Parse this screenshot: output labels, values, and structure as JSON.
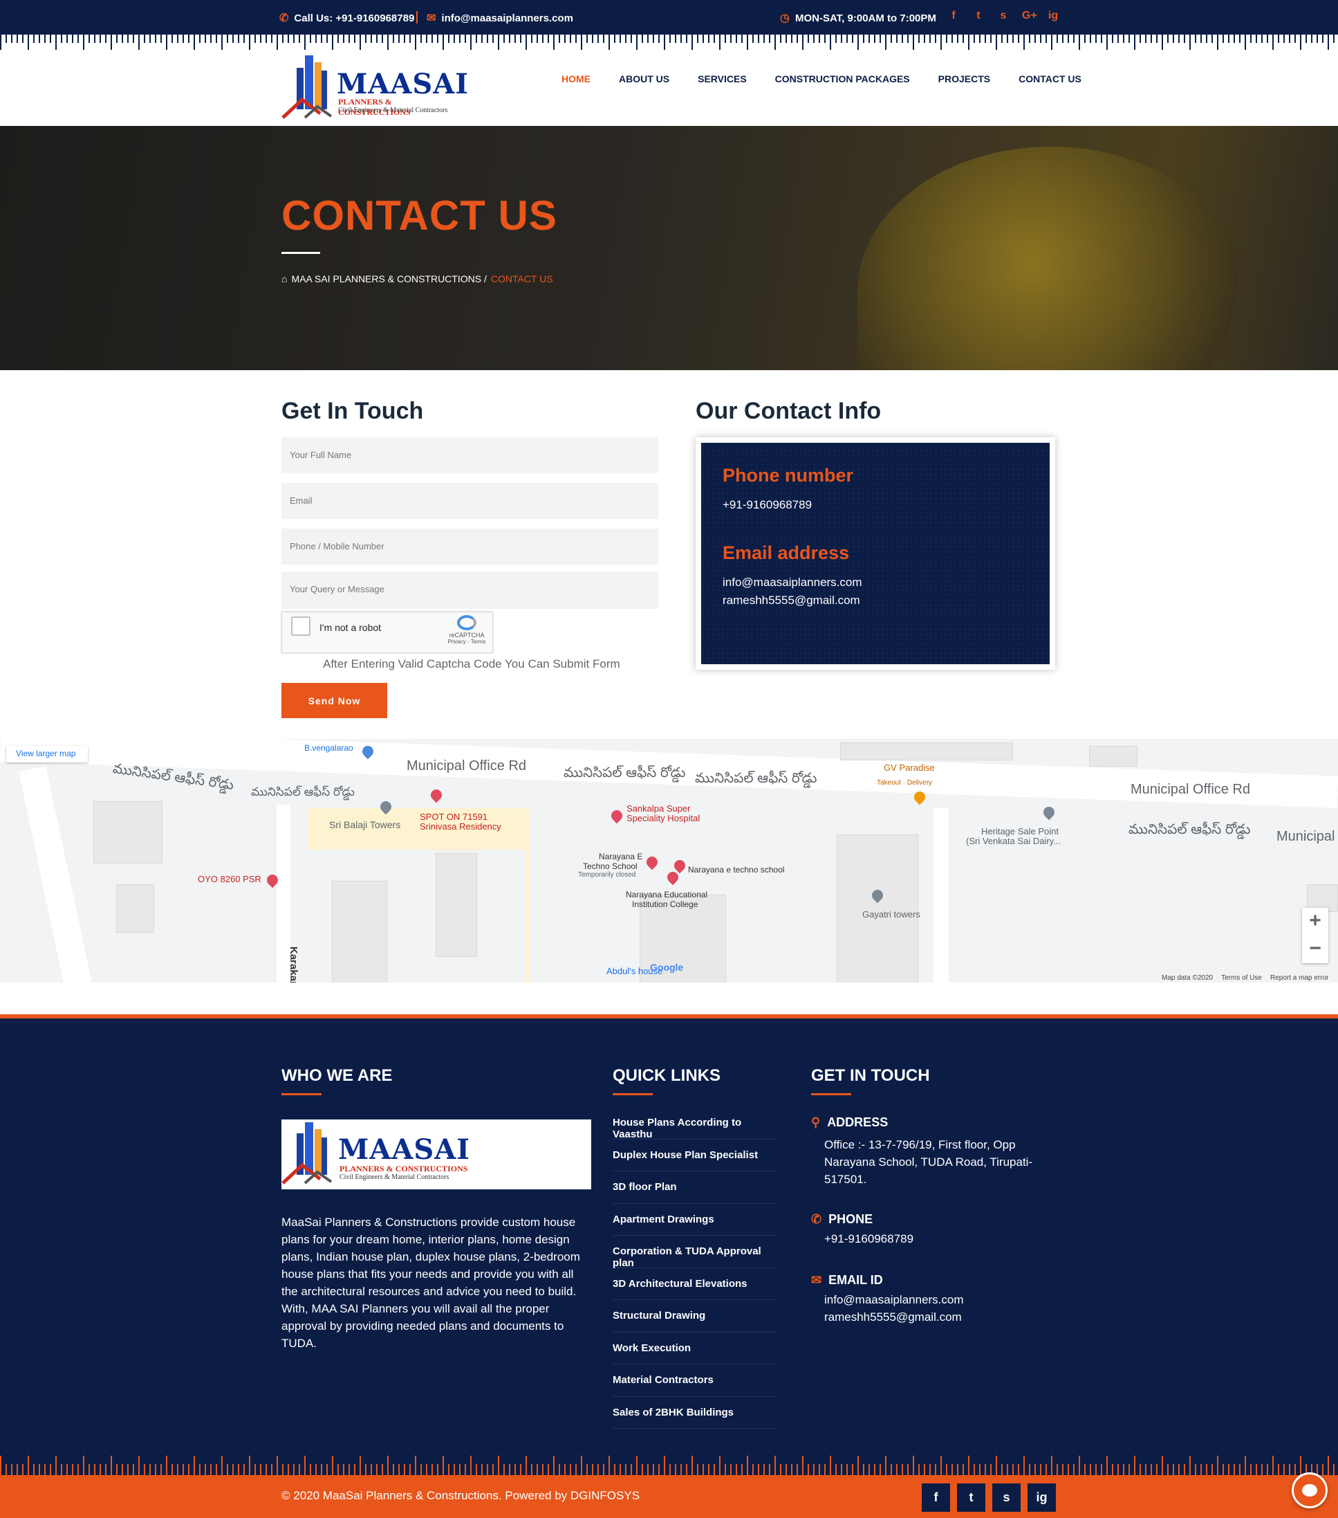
{
  "topbar": {
    "call": "Call Us: +91-9160968789",
    "email": "info@maasaiplanners.com",
    "hours": "MON-SAT, 9:00AM to 7:00PM",
    "social": [
      "f",
      "t",
      "s",
      "G+",
      "ig"
    ]
  },
  "logo": {
    "main": "MAASAI",
    "sub1": "PLANNERS & CONSTRUCTIONS",
    "sub2": "Civil Engineers & Material Contractors"
  },
  "nav": [
    "HOME",
    "ABOUT US",
    "SERVICES",
    "CONSTRUCTION PACKAGES",
    "PROJECTS",
    "CONTACT US"
  ],
  "hero": {
    "title": "CONTACT US",
    "crumb_home": "MAA SAI PLANNERS & CONSTRUCTIONS /",
    "crumb_current": "CONTACT US"
  },
  "form": {
    "title": "Get In Touch",
    "name_ph": "Your Full Name",
    "email_ph": "Email",
    "phone_ph": "Phone / Mobile Number",
    "message_ph": "Your Query or Message",
    "captcha_label": "I'm not a robot",
    "captcha_brand": "reCAPTCHA",
    "captcha_links": "Privacy - Terms",
    "note": "After Entering Valid Captcha Code You Can Submit Form",
    "submit": "Send Now"
  },
  "contact_info": {
    "title": "Our Contact Info",
    "phone_title": "Phone number",
    "phone": "+91-9160968789",
    "email_title": "Email address",
    "email1": "info@maasaiplanners.com",
    "email2": "rameshh5555@gmail.com"
  },
  "map": {
    "view_larger": "View larger map",
    "labels": {
      "road1": "Municipal Office Rd",
      "road2": "Municipal Office Rd",
      "road3": "Municipal",
      "telugu": "మునిసిపల్ ఆఫీస్ రోడ్డు",
      "balaji": "Sri Balaji Towers",
      "spot": "SPOT ON 71591",
      "srinivasa": "Srinivasa Residency",
      "sankalpa": "Sankalpa Super",
      "speciality": "Speciality Hospital",
      "narayana_e": "Narayana E",
      "techno": "Techno School",
      "closed": "Temporarily closed",
      "narayana_techno": "Narayana e techno school",
      "narayana_edu": "Narayana Educational",
      "institution": "Institution College",
      "oyo": "OYO 8260 PSR",
      "karakambadi": "Karakambadi Bazi",
      "vengalarao": "B.vengalarao",
      "gv": "GV Paradise",
      "takeout": "Takeout · Delivery",
      "heritage": "Heritage Sale Point",
      "dairy": "(Sri Venkata Sai Dairy...",
      "gayatri": "Gayatri towers",
      "abdul": "Abdul's house"
    },
    "google": "Google",
    "footer": [
      "Map data ©2020",
      "Terms of Use",
      "Report a map error"
    ]
  },
  "footer": {
    "who_title": "WHO WE ARE",
    "about": "MaaSai Planners & Constructions provide custom house plans for your dream home, interior plans, home design plans, Indian house plan, duplex house plans, 2-bedroom house plans that fits your needs and provide you with all the architectural resources and advice you need to build. With, MAA SAI Planners you will avail all the proper approval by providing needed plans and documents to TUDA.",
    "quick_title": "QUICK LINKS",
    "links": [
      "House Plans According to Vaasthu",
      "Duplex House Plan Specialist",
      "3D floor Plan",
      "Apartment Drawings",
      "Corporation & TUDA Approval plan",
      "3D Architectural Elevations",
      "Structural Drawing",
      "Work Execution",
      "Material Contractors",
      "Sales of 2BHK Buildings"
    ],
    "touch_title": "GET IN TOUCH",
    "address_title": "ADDRESS",
    "address": "Office :- 13-7-796/19, First floor, Opp Narayana School, TUDA Road, Tirupati-517501.",
    "phone_title": "PHONE",
    "phone": "+91-9160968789",
    "email_title": "EMAIL ID",
    "email1": "info@maasaiplanners.com",
    "email2": "rameshh5555@gmail.com",
    "copyright": "© 2020 MaaSai Planners & Constructions. Powered by DGINFOSYS",
    "social": [
      "f",
      "t",
      "s",
      "ig"
    ]
  }
}
